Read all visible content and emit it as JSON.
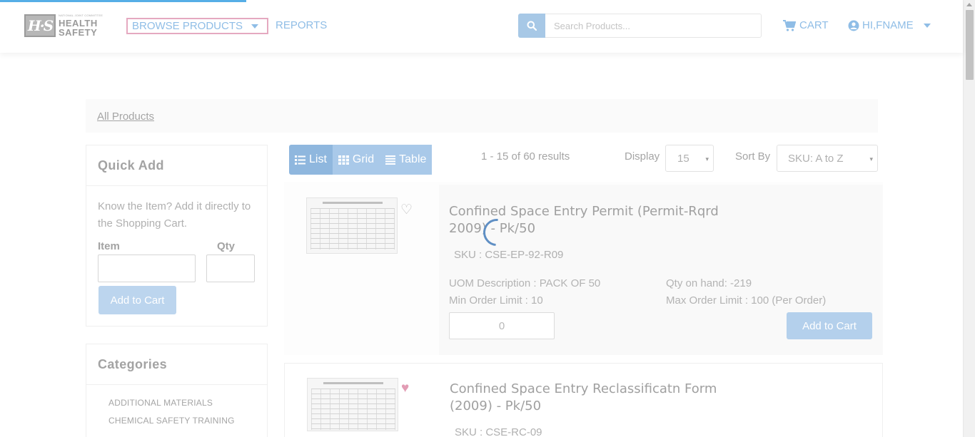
{
  "header": {
    "logo_small": "NATIONAL JOINT COMMITTEE",
    "logo_line1": "HEALTH",
    "logo_line2": "SAFETY",
    "logo_mark": "H·S",
    "nav_browse": "BROWSE PRODUCTS",
    "nav_reports": "REPORTS",
    "search_placeholder": "Search Products...",
    "cart": "CART",
    "user": "HI,FNAME"
  },
  "breadcrumb": {
    "label": "All Products"
  },
  "quick_add": {
    "title": "Quick Add",
    "description": "Know the Item? Add it directly to the Shopping Cart.",
    "item_label": "Item",
    "qty_label": "Qty",
    "button": "Add to Cart"
  },
  "categories": {
    "title": "Categories",
    "items": [
      "ADDITIONAL MATERIALS",
      "CHEMICAL SAFETY TRAINING"
    ]
  },
  "toolbar": {
    "view_list": "List",
    "view_grid": "Grid",
    "view_table": "Table",
    "results": "1 - 15 of 60 results",
    "display_label": "Display",
    "display_value": "15",
    "sort_label": "Sort By",
    "sort_value": "SKU: A to Z"
  },
  "products": [
    {
      "name": "Confined Space Entry Permit (Permit-Rqrd 2009) - Pk/50",
      "sku": "SKU : CSE-EP-92-R09",
      "uom": "UOM Description : PACK OF 50",
      "qty_on_hand": "Qty on hand: -219",
      "min_order": "Min Order Limit : 10",
      "max_order": "Max Order Limit : 100 (Per Order)",
      "qty_value": "0",
      "add_button": "Add to Cart",
      "favorite": false
    },
    {
      "name": "Confined Space Entry Reclassificatn Form (2009) - Pk/50",
      "sku": "SKU : CSE-RC-09",
      "favorite": true
    }
  ],
  "colors": {
    "accent": "#8fbde6",
    "button": "#b4d0ec",
    "heart": "#e29cb4"
  }
}
